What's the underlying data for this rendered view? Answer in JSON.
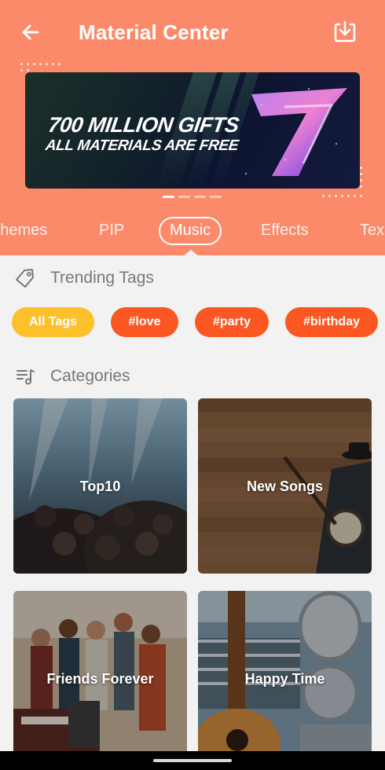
{
  "header": {
    "title": "Material Center",
    "back_icon": "arrow-left-icon",
    "download_icon": "download-tray-icon",
    "background_color": "#fb8a6a"
  },
  "banner": {
    "line1": "700 MILLION GIFTS",
    "line2": "ALL MATERIALS ARE FREE",
    "pager": {
      "total": 4,
      "active": 1
    }
  },
  "tabs": [
    {
      "label": "Themes",
      "active": false
    },
    {
      "label": "PIP",
      "active": false
    },
    {
      "label": "Music",
      "active": true
    },
    {
      "label": "Effects",
      "active": false
    },
    {
      "label": "Tex",
      "active": false
    }
  ],
  "trending": {
    "heading": "Trending Tags",
    "icon": "tag-icon",
    "chips": [
      {
        "label": "All Tags",
        "active": true
      },
      {
        "label": "#love",
        "active": false
      },
      {
        "label": "#party",
        "active": false
      },
      {
        "label": "#birthday",
        "active": false
      }
    ],
    "active_color": "#fcc02b",
    "tag_color": "#fc5723"
  },
  "categories": {
    "heading": "Categories",
    "icon": "music-list-icon",
    "items": [
      {
        "label": "Top10"
      },
      {
        "label": "New Songs"
      },
      {
        "label": "Friends Forever"
      },
      {
        "label": "Happy Time"
      }
    ]
  }
}
